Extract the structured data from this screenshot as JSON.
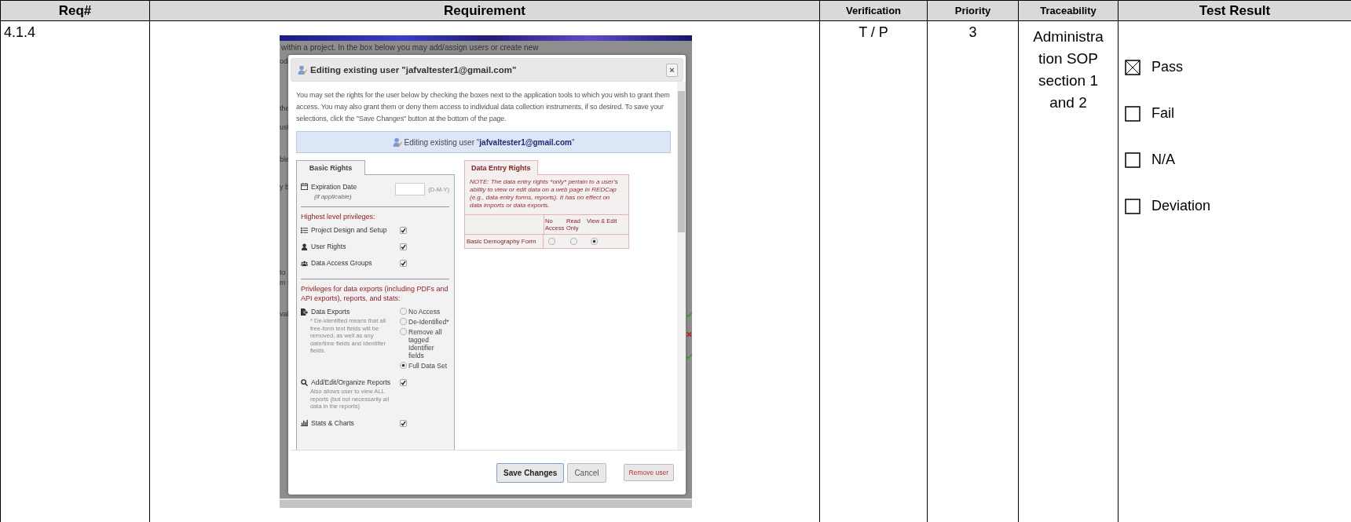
{
  "header": [
    {
      "label": "Req#"
    },
    {
      "label": "Requirement"
    },
    {
      "label": "Verification"
    },
    {
      "label": "Priority"
    },
    {
      "label": "Traceability"
    },
    {
      "label": "Test Result"
    }
  ],
  "row": {
    "req": "4.1.4",
    "verification": "T / P",
    "priority": "3",
    "traceability": "Administration SOP section 1 and 2",
    "test_result": [
      {
        "label": "Pass",
        "checked": true
      },
      {
        "label": "Fail",
        "checked": false
      },
      {
        "label": "N/A",
        "checked": false
      },
      {
        "label": "Deviation",
        "checked": false
      }
    ],
    "screenshot": {
      "page_text": "within a project. In the box below you may add/assign users or create new",
      "page_fragments": [
        "odi",
        "the",
        "ust",
        "ble",
        "y b",
        "to",
        "m t",
        "val"
      ],
      "status_marks": [
        {
          "kind": "ok"
        },
        {
          "kind": "error"
        },
        {
          "kind": "ok"
        }
      ],
      "dialog": {
        "title": "Editing existing user \"jafvaltester1@gmail.com\"",
        "close": "×",
        "intro": "You may set the rights for the user below by checking the boxes next to the application tools to which you wish to grant them access. You may also grant them or deny them access to individual data collection instruments, if so desired. To save your selections, click the \"Save Changes\" button at the bottom of the page.",
        "banner": "Editing existing user \"**jafvaltester1@gmail.com**\"",
        "basic_rights": {
          "tab": "Basic Rights",
          "expiration": {
            "label": "Expiration Date",
            "hint": "(if applicable)",
            "format": "(D-M-Y)"
          },
          "sections": [
            {
              "heading": "Highest level privileges:",
              "items": [
                {
                  "kind": "checkbox",
                  "label": "Project Design and Setup",
                  "checked": true
                },
                {
                  "kind": "checkbox",
                  "label": "User Rights",
                  "checked": true
                },
                {
                  "kind": "checkbox",
                  "label": "Data Access Groups",
                  "checked": true
                }
              ]
            },
            {
              "heading": "Privileges for data exports (including PDFs and API exports), reports, and stats:",
              "items": [
                {
                  "kind": "radio",
                  "label": "Data Exports",
                  "note": "* De-identified means that all free-form text fields will be removed, as well as any date/time fields and Identifier fields.",
                  "options": [
                    {
                      "label": "No Access",
                      "selected": false
                    },
                    {
                      "label": "De-Identified*",
                      "selected": false
                    },
                    {
                      "label": "Remove all tagged Identifier fields",
                      "selected": false
                    },
                    {
                      "label": "Full Data Set",
                      "selected": true
                    }
                  ]
                },
                {
                  "kind": "checkbox",
                  "label": "Add/Edit/Organize Reports",
                  "note": "Also allows user to view ALL reports (but not necessarily all data in the reports)",
                  "checked": true
                },
                {
                  "kind": "checkbox",
                  "label": "Stats & Charts",
                  "checked": true
                }
              ]
            }
          ]
        },
        "data_entry": {
          "tab": "Data Entry Rights",
          "note": "NOTE: The data entry rights *only* pertain to a user's ability to view or edit data on a web page in REDCap (e.g., data entry forms, reports). It has no effect on data imports or data exports.",
          "columns": [
            "No Access",
            "Read Only",
            "View & Edit"
          ],
          "forms": [
            {
              "name": "Basic Demography Form",
              "options": [
                {
                  "selected": false
                },
                {
                  "selected": false
                },
                {
                  "selected": true
                }
              ]
            }
          ]
        },
        "buttons": [
          {
            "kind": "primary",
            "label": "Save Changes"
          },
          {
            "kind": "default",
            "label": "Cancel"
          },
          {
            "kind": "danger",
            "label": "Remove user"
          }
        ]
      }
    }
  }
}
